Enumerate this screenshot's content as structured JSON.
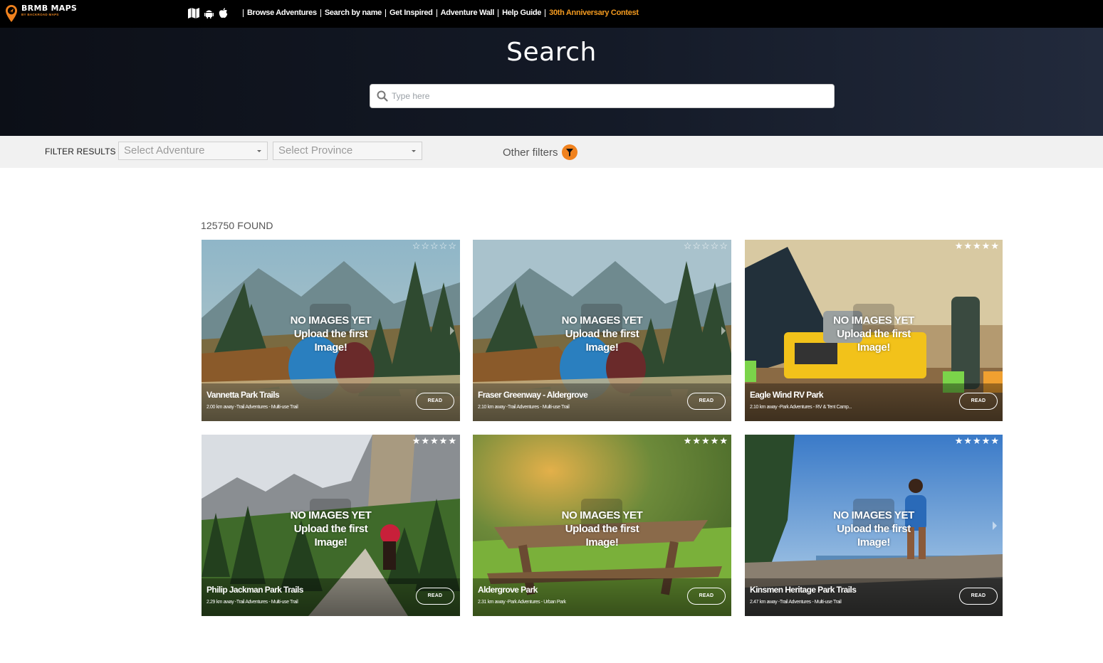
{
  "nav": {
    "logo_title": "BRMB MAPS",
    "logo_sub": "BY BACKROAD MAPS",
    "icons": [
      "map-icon",
      "android-icon",
      "apple-icon"
    ],
    "links": [
      {
        "label": "Browse Adventures"
      },
      {
        "label": "Search by name"
      },
      {
        "label": "Get Inspired"
      },
      {
        "label": "Adventure Wall"
      },
      {
        "label": "Help Guide"
      },
      {
        "label": "30th Anniversary Contest",
        "accent": "#f39a1f"
      }
    ]
  },
  "hero": {
    "title": "Search",
    "search_placeholder": "Type here"
  },
  "filters": {
    "label": "FILTER RESULTS",
    "adventure_select": "Select Adventure",
    "province_select": "Select Province",
    "other_filters": "Other filters",
    "accent_color": "#f0821e"
  },
  "results": {
    "found": "125750 FOUND",
    "no_images_line1": "NO IMAGES YET",
    "no_images_line2": "Upload the first",
    "no_images_line3": "Image!",
    "read_label": "READ",
    "cards": [
      {
        "name": "Vannetta Park Trails",
        "meta": "2.00 km away -Trail Adventures - Multi-use Trail",
        "stars": "☆☆☆☆☆",
        "scene": "mountain-hiker"
      },
      {
        "name": "Fraser Greenway - Aldergrove",
        "meta": "2.10 km away -Trail Adventures - Multi-use Trail",
        "stars": "☆☆☆☆☆",
        "scene": "mountain-hiker"
      },
      {
        "name": "Eagle Wind RV Park",
        "meta": "2.10 km away -Park Adventures - RV & Tent Camp...",
        "stars": "★★★★★",
        "scene": "camp-stove"
      },
      {
        "name": "Philip Jackman Park Trails",
        "meta": "2.29 km away -Trail Adventures - Multi-use Trail",
        "stars": "★★★★★",
        "scene": "horse-trail"
      },
      {
        "name": "Aldergrove Park",
        "meta": "2.31 km away -Park Adventures - Urban Park",
        "stars": "★★★★★",
        "scene": "picnic-table"
      },
      {
        "name": "Kinsmen Heritage Park Trails",
        "meta": "2.47 km away -Trail Adventures - Multi-use Trail",
        "stars": "★★★★★",
        "scene": "beach-hiker"
      }
    ]
  }
}
